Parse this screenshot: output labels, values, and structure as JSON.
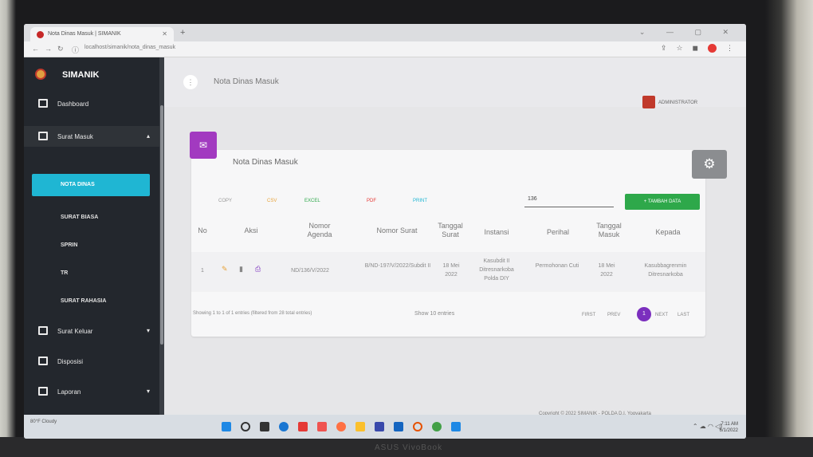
{
  "browser": {
    "tab_title": "Nota Dinas Masuk | SIMANIK",
    "url": "localhost/simanik/nota_dinas_masuk"
  },
  "sidebar": {
    "app_name": "SIMANIK",
    "items": [
      {
        "label": "Dashboard",
        "icon": "dashboard-icon"
      },
      {
        "label": "Surat Masuk",
        "icon": "inbox-icon"
      },
      {
        "label": "Surat Keluar",
        "icon": "outbox-icon"
      },
      {
        "label": "Disposisi",
        "icon": "disposition-icon"
      },
      {
        "label": "Laporan",
        "icon": "report-icon"
      }
    ],
    "sub_items": [
      "NOTA DINAS",
      "SURAT BIASA",
      "SPRIN",
      "TR",
      "SURAT RAHASIA"
    ]
  },
  "header": {
    "page_title": "Nota Dinas Masuk",
    "user": "ADMINISTRATOR"
  },
  "card": {
    "title": "Nota Dinas Masuk",
    "export_buttons": [
      "COPY",
      "CSV",
      "EXCEL",
      "PDF",
      "PRINT"
    ],
    "search_value": "136",
    "add_button": "+ TAMBAH DATA"
  },
  "table": {
    "headers": [
      "No",
      "Aksi",
      "Nomor Agenda",
      "Nomor Surat",
      "Tanggal Surat",
      "Instansi",
      "Perihal",
      "Tanggal Masuk",
      "Kepada"
    ],
    "rows": [
      {
        "no": "1",
        "agenda": "ND/136/V/2022",
        "surat": "B/ND-197/V/2022/Subdit II",
        "tgl_surat": "18 Mei 2022",
        "instansi": "Kasubdit II Ditresnarkoba Polda DIY",
        "perihal": "Permohonan Cuti",
        "tgl_masuk": "18 Mei 2022",
        "kepada": "Kasubbagrenmin Ditresnarkoba"
      }
    ],
    "info": "Showing 1 to 1 of 1 entries (filtered from 28 total entries)",
    "show_entries": "Show 10 entries",
    "pagination": {
      "first": "FIRST",
      "prev": "PREV",
      "current": "1",
      "next": "NEXT",
      "last": "LAST"
    }
  },
  "footer": "Copyright © 2022 SIMANIK - POLDA D.I. Yogyakarta",
  "taskbar": {
    "weather": "80°F Cloudy",
    "time": "7:11 AM",
    "date": "6/1/2022"
  },
  "laptop_brand": "ASUS VivoBook",
  "colors": {
    "sidebar_bg": "#23272d",
    "active_sub": "#1fb6d3",
    "card_icon": "#a23ac0",
    "add_button": "#2ea84a",
    "pagination_current": "#7b2fbe"
  }
}
